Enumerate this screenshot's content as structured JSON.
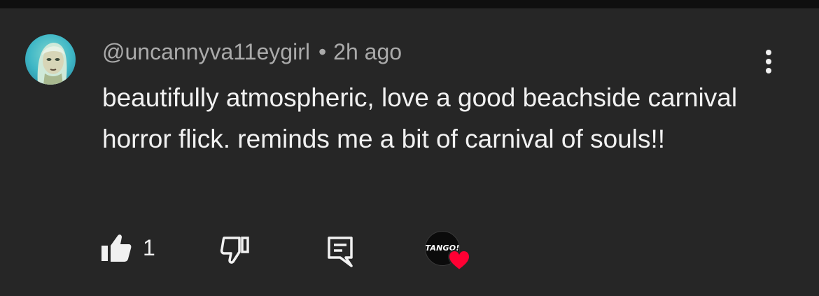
{
  "comment": {
    "author": "@uncannyva11eygirl",
    "separator": "•",
    "time": "2h ago",
    "text": "beautifully atmospheric, love a good beachside carnival horror flick. reminds me a bit of carnival of souls!!",
    "avatar_icon": "user-avatar"
  },
  "actions": {
    "like_icon": "thumbs-up-icon",
    "like_count": "1",
    "dislike_icon": "thumbs-down-icon",
    "reply_icon": "reply-comment-icon",
    "creator_heart": {
      "logo_text": "TANGO!",
      "heart_color": "#ff0033"
    }
  },
  "menu": {
    "icon": "more-vertical-icon"
  },
  "colors": {
    "background": "#262626",
    "primary_text": "#f1f1f1",
    "secondary_text": "#aaaaaa"
  }
}
